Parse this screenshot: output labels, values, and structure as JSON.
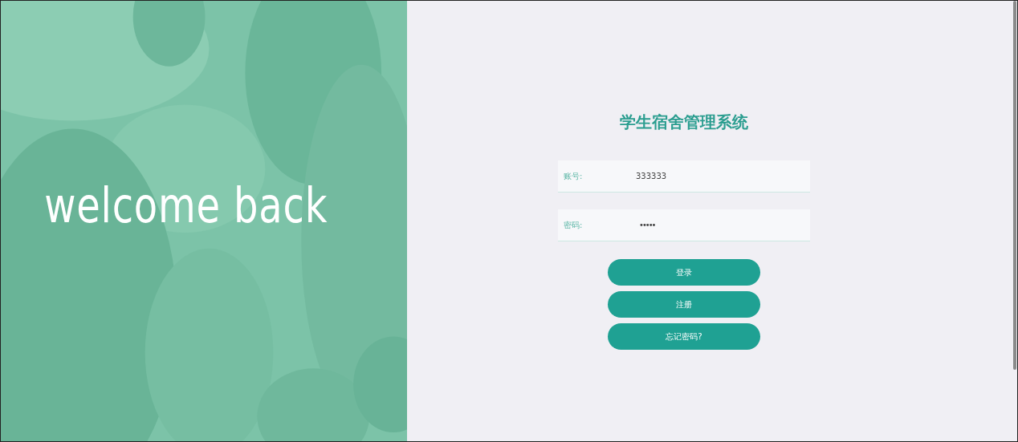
{
  "hero": {
    "heading": "welcome back"
  },
  "login": {
    "title": "学生宿舍管理系统",
    "fields": [
      {
        "label": "账号:",
        "value": "333333",
        "kind": "text"
      },
      {
        "label": "密码:",
        "value": "•••••",
        "kind": "password"
      }
    ],
    "buttons": [
      "登录",
      "注册",
      "忘记密码?"
    ]
  }
}
